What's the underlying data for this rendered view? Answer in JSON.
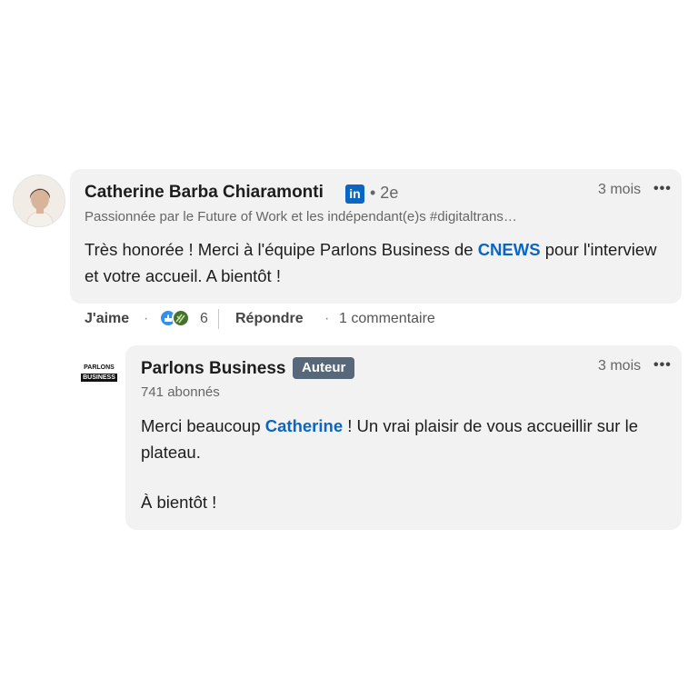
{
  "comment": {
    "author_name": "Catherine Barba Chiaramonti",
    "network_badge": "in",
    "degree": "• 2e",
    "headline": "Passionnée par le Future of Work et les indépendant(e)s #digitaltrans…",
    "time": "3 mois",
    "more": "•••",
    "text_part1": "Très honorée ! Merci à l'équipe Parlons Business de ",
    "text_mention": "CNEWS",
    "text_part2": " pour l'interview et votre accueil. A bientôt !",
    "actions": {
      "like_label": "J'aime",
      "separator": "·",
      "reaction_count": "6",
      "reply_label": "Répondre",
      "replies_label": "1 commentaire"
    }
  },
  "reply": {
    "author_name": "Parlons Business",
    "author_badge": "Auteur",
    "logo_line1": "PARLONS",
    "logo_line2": "BUSINESS",
    "followers": "741 abonnés",
    "time": "3 mois",
    "more": "•••",
    "text_part1": "Merci beaucoup ",
    "text_mention": "Catherine",
    "text_part2": " ! Un vrai plaisir de vous accueillir sur le plateau.",
    "text_line2": "À bientôt !"
  },
  "colors": {
    "link_blue": "#0a66c2",
    "bubble_bg": "#f2f2f2",
    "author_badge_bg": "#56687a"
  }
}
